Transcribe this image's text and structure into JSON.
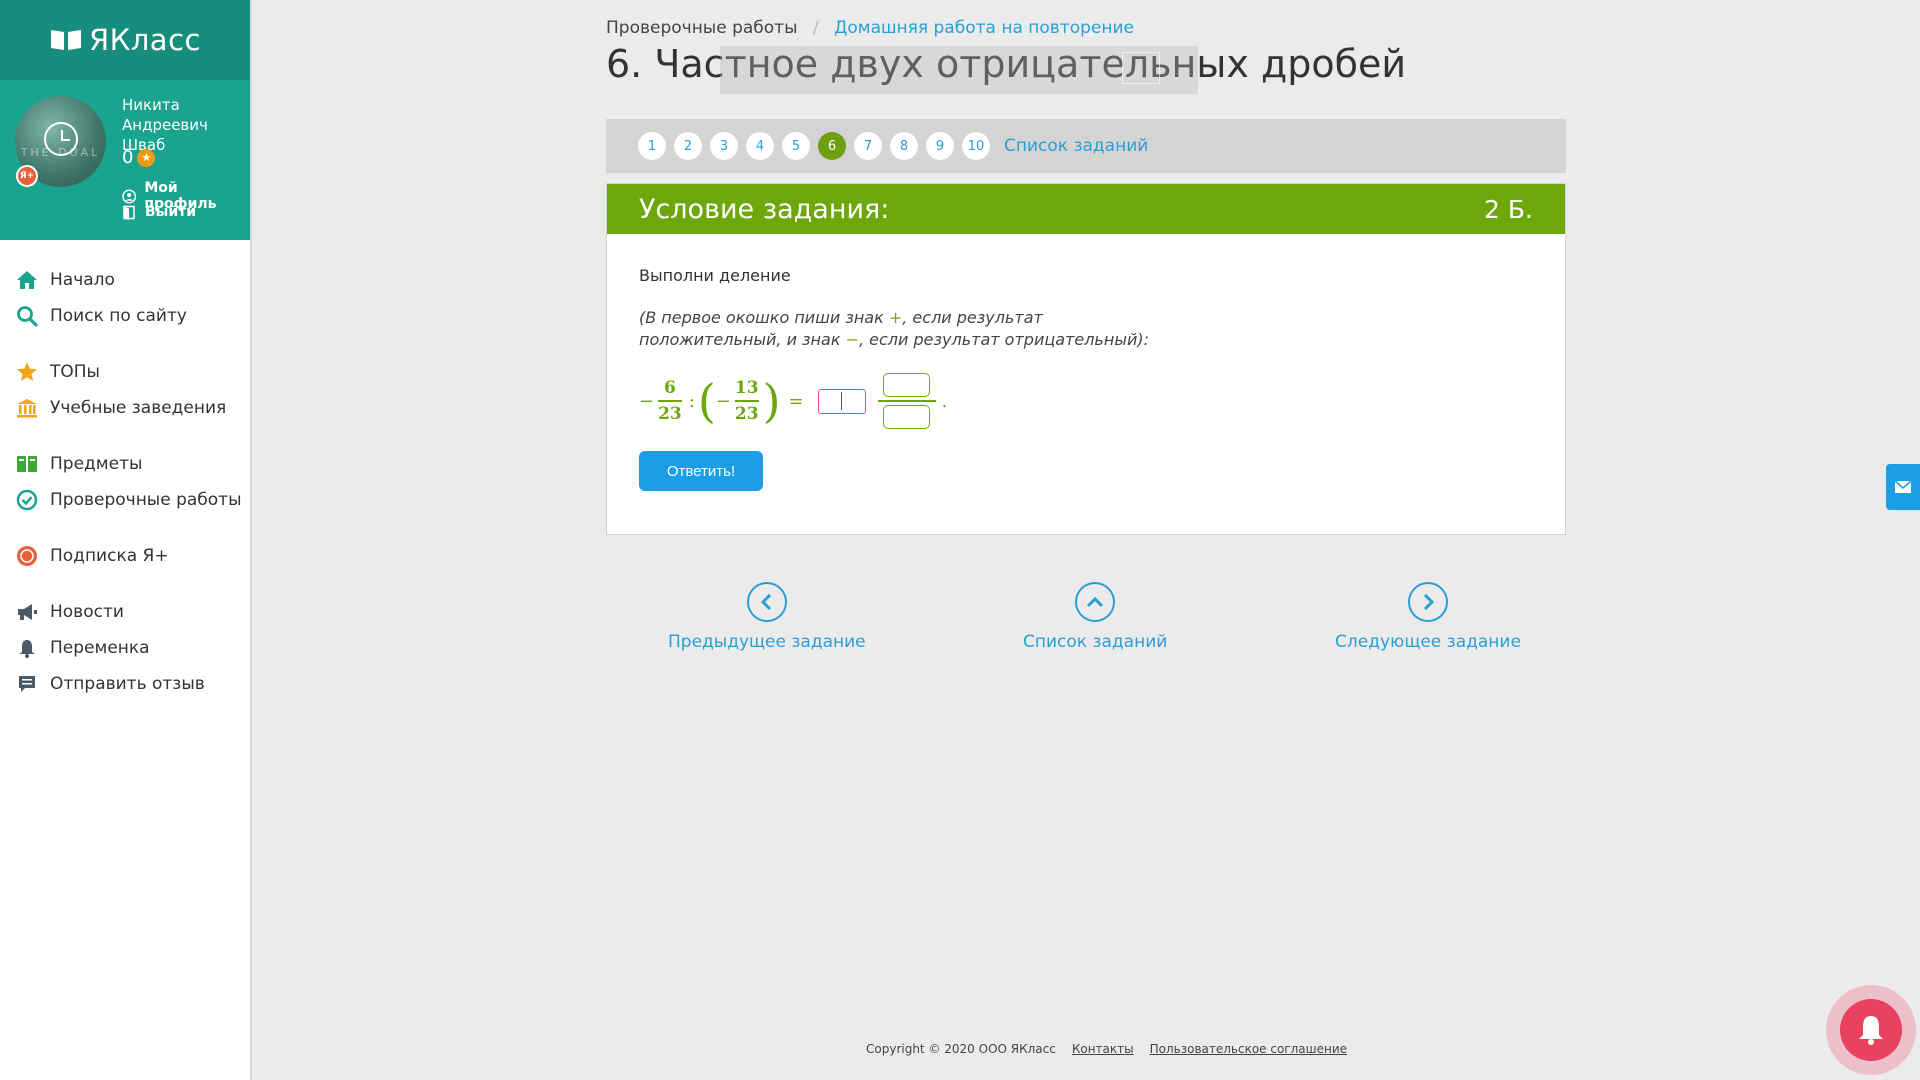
{
  "app": {
    "logo_text": "ЯКласс"
  },
  "user": {
    "name": "Никита Андреевич Шваб",
    "score": "0",
    "badge": "Я+",
    "avatar_text": "THE DUAL",
    "profile_link": "Мой профиль",
    "logout_link": "Выйти"
  },
  "sidebar": {
    "groups": [
      [
        {
          "label": "Начало",
          "icon": "home-icon"
        },
        {
          "label": "Поиск по сайту",
          "icon": "search-icon"
        }
      ],
      [
        {
          "label": "ТОПы",
          "icon": "star-icon"
        },
        {
          "label": "Учебные заведения",
          "icon": "institution-icon"
        }
      ],
      [
        {
          "label": "Предметы",
          "icon": "books-icon"
        },
        {
          "label": "Проверочные работы",
          "icon": "check-circle-icon"
        }
      ],
      [
        {
          "label": "Подписка Я+",
          "icon": "subscription-icon"
        }
      ],
      [
        {
          "label": "Новости",
          "icon": "megaphone-icon"
        },
        {
          "label": "Переменка",
          "icon": "bell-icon"
        },
        {
          "label": "Отправить отзыв",
          "icon": "comment-icon"
        }
      ]
    ]
  },
  "breadcrumb": {
    "root": "Проверочные работы",
    "current": "Домашняя работа на повторение"
  },
  "page": {
    "title": "6. Частное двух отрицательных дробей"
  },
  "task_nav": {
    "numbers": [
      "1",
      "2",
      "3",
      "4",
      "5",
      "6",
      "7",
      "8",
      "9",
      "10"
    ],
    "active": "6",
    "list_link": "Список заданий"
  },
  "task": {
    "header": "Условие задания:",
    "points": "2 Б.",
    "instruction": "Выполни деление",
    "hint_part1": "(В первое окошко пиши знак ",
    "hint_plus": "+",
    "hint_part2": ", если результат положительный, и знак ",
    "hint_minus": "−",
    "hint_part3": ", если результат отрицательный):",
    "formula": {
      "minus1": "−",
      "num1": "6",
      "den1": "23",
      "colon": ":",
      "lparen": "(",
      "minus2": "−",
      "num2": "13",
      "den2": "23",
      "rparen": ")",
      "equals": "=",
      "period": "."
    },
    "answer_button": "Ответить!"
  },
  "bottom_nav": {
    "prev": "Предыдущее задание",
    "list": "Список заданий",
    "next": "Следующее задание"
  },
  "footer": {
    "copyright": "Copyright © 2020 ООО ЯКласс",
    "contacts": "Контакты",
    "agreement": "Пользовательское соглашение"
  },
  "colors": {
    "teal": "#1aa38f",
    "green": "#6ea70a",
    "blue": "#1a9ee5",
    "link": "#2a9fd6"
  }
}
